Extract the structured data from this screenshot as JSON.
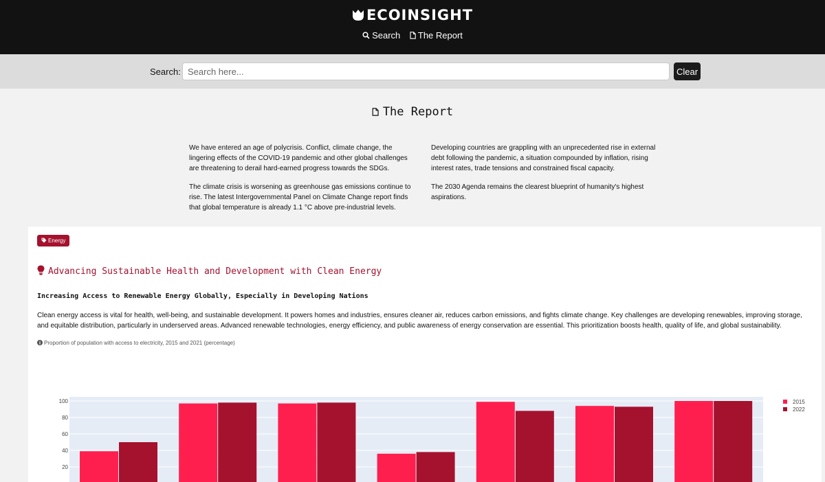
{
  "header": {
    "brand": "ECOINSIGHT",
    "nav": [
      {
        "label": "Search",
        "icon": "search-icon"
      },
      {
        "label": "The Report",
        "icon": "document-icon"
      }
    ]
  },
  "search": {
    "label": "Search:",
    "placeholder": "Search here...",
    "value": "",
    "clear_label": "Clear"
  },
  "report": {
    "title": "The Report",
    "left_paragraphs": [
      "We have entered an age of polycrisis. Conflict, climate change, the lingering effects of the COVID-19 pandemic and other global challenges are threatening to derail hard-earned progress towards the SDGs.",
      "The climate crisis is worsening as greenhouse gas emissions continue to rise. The latest Intergovernmental Panel on Climate Change report finds that global temperature is already 1.1 °C above pre-industrial levels."
    ],
    "right_paragraphs": [
      "Developing countries are grappling with an unprecedented rise in external debt following the pandemic, a situation compounded by inflation, rising interest rates, trade tensions and constrained fiscal capacity.",
      "The 2030 Agenda remains the clearest blueprint of humanity's highest aspirations."
    ]
  },
  "card": {
    "tag": "Energy",
    "title": "Advancing Sustainable Health and Development with Clean Energy",
    "subtitle": "Increasing Access to Renewable Energy Globally, Especially in Developing Nations",
    "body": "Clean energy access is vital for health, well-being, and sustainable development. It powers homes and industries, ensures cleaner air, reduces carbon emissions, and fights climate change. Key challenges are developing renewables, improving storage, and equitable distribution, particularly in underserved areas. Advanced renewable technologies, energy efficiency, and public awareness of energy conservation are essential. This prioritization boosts health, quality of life, and global sustainability.",
    "chart_caption": "Proportion of population with access to electricity, 2015 and 2021 (percentage)"
  },
  "colors": {
    "header_bg": "#121212",
    "accent": "#a5122e",
    "series_2015": "#ff1f4f",
    "series_2022": "#a5122e",
    "plot_bg": "#e5ecf6"
  },
  "chart_data": {
    "type": "bar",
    "categories": [
      "",
      "",
      "",
      "",
      "",
      "",
      ""
    ],
    "series": [
      {
        "name": "2015",
        "values": [
          39,
          97,
          97,
          36,
          99,
          94,
          100
        ]
      },
      {
        "name": "2022",
        "values": [
          50,
          98,
          98,
          38,
          88,
          93,
          100
        ]
      }
    ],
    "ylim": [
      0,
      106
    ],
    "yticks": [
      20,
      40,
      60,
      80,
      100
    ],
    "grid": true,
    "legend_position": "top-right"
  }
}
